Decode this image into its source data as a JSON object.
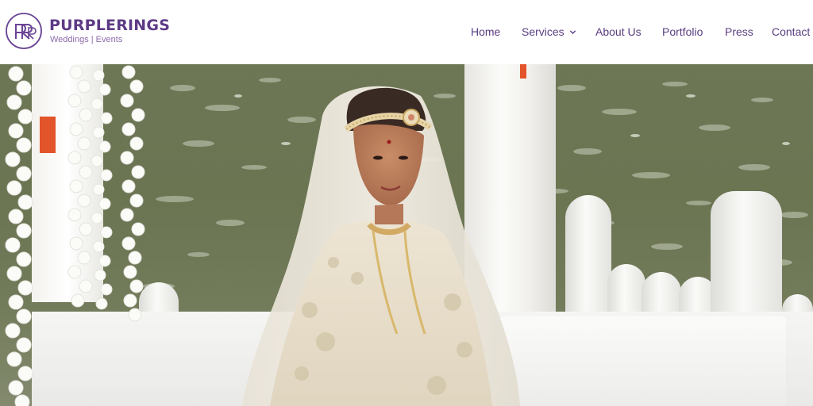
{
  "brand": {
    "name": "PURPLERINGS",
    "tagline": "Weddings | Events",
    "logo_icon": "purplerings-monogram",
    "color": "#5e3a86"
  },
  "nav": {
    "items": [
      {
        "label": "Home",
        "has_dropdown": false
      },
      {
        "label": "Services",
        "has_dropdown": true
      },
      {
        "label": "About Us",
        "has_dropdown": false
      },
      {
        "label": "Portfolio",
        "has_dropdown": false
      },
      {
        "label": "Press",
        "has_dropdown": false
      },
      {
        "label": "Contact",
        "has_dropdown": false
      }
    ],
    "dropdown_icon": "chevron-down-icon",
    "color": "#5a3d82"
  },
  "hero": {
    "subject": "bride-photo"
  }
}
